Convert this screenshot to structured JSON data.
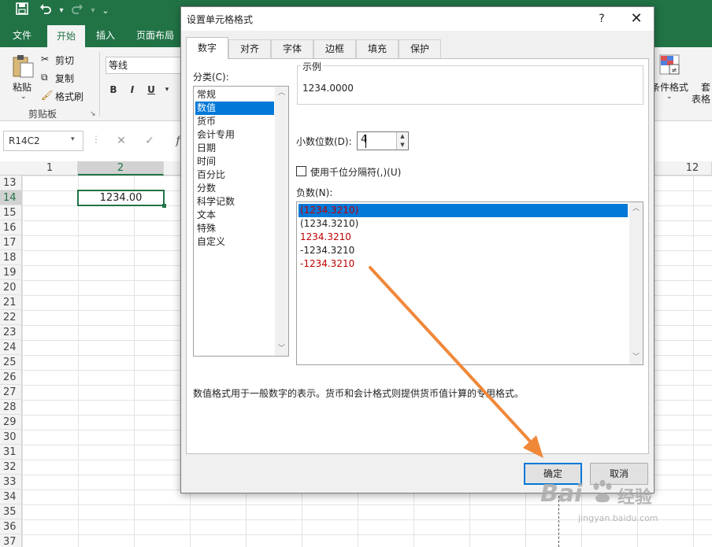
{
  "excel": {
    "quick_access": {
      "save_icon": "save-icon",
      "undo_icon": "undo-icon",
      "redo_icon": "redo-icon",
      "customize_icon": "customize-icon"
    },
    "tabs": [
      "文件",
      "开始",
      "插入",
      "页面布局"
    ],
    "active_tab": "开始",
    "ribbon": {
      "paste": "粘贴",
      "cut": "剪切",
      "copy": "复制",
      "format_painter": "格式刷",
      "clipboard_group": "剪贴板",
      "font_name": "等线",
      "bold": "B",
      "italic": "I",
      "underline": "U",
      "conditional_format": "条件格式",
      "table_format_partial": "套",
      "table_format_partial2": "表格"
    },
    "name_box": "R14C2",
    "fx_label": "f",
    "columns": [
      "1",
      "2",
      "12"
    ],
    "rows": [
      "13",
      "14",
      "15",
      "16",
      "17",
      "18",
      "19",
      "20",
      "21",
      "22",
      "23",
      "24",
      "25",
      "26",
      "27",
      "28",
      "29",
      "30",
      "31",
      "32",
      "33",
      "34",
      "35",
      "36",
      "37"
    ],
    "active_cell_value": "1234.00"
  },
  "dialog": {
    "title": "设置单元格格式",
    "help": "?",
    "close": "✕",
    "tabs": [
      "数字",
      "对齐",
      "字体",
      "边框",
      "填充",
      "保护"
    ],
    "active_tab": "数字",
    "category_label": "分类(C):",
    "categories": [
      "常规",
      "数值",
      "货币",
      "会计专用",
      "日期",
      "时间",
      "百分比",
      "分数",
      "科学记数",
      "文本",
      "特殊",
      "自定义"
    ],
    "selected_category": "数值",
    "sample_label": "示例",
    "sample_value": "1234.0000",
    "decimal_label": "小数位数(D):",
    "decimal_value": "4",
    "thousands_label": "使用千位分隔符(,)(U)",
    "negative_label": "负数(N):",
    "negative_formats": [
      {
        "text": "(1234.3210)",
        "color": "#c00000"
      },
      {
        "text": "(1234.3210)",
        "color": "#222222"
      },
      {
        "text": "1234.3210",
        "color": "#c00000"
      },
      {
        "text": "-1234.3210",
        "color": "#222222"
      },
      {
        "text": "-1234.3210",
        "color": "#c00000"
      }
    ],
    "description": "数值格式用于一般数字的表示。货币和会计格式则提供货币值计算的专用格式。",
    "ok": "确定",
    "cancel": "取消"
  },
  "watermark": {
    "brand": "Bai",
    "brand2": "经验",
    "url": "jingyan.baidu.com"
  },
  "colors": {
    "excel_green": "#217346",
    "selection_blue": "#0078d7",
    "negative_red": "#c00000",
    "arrow_orange": "#f0883a"
  }
}
